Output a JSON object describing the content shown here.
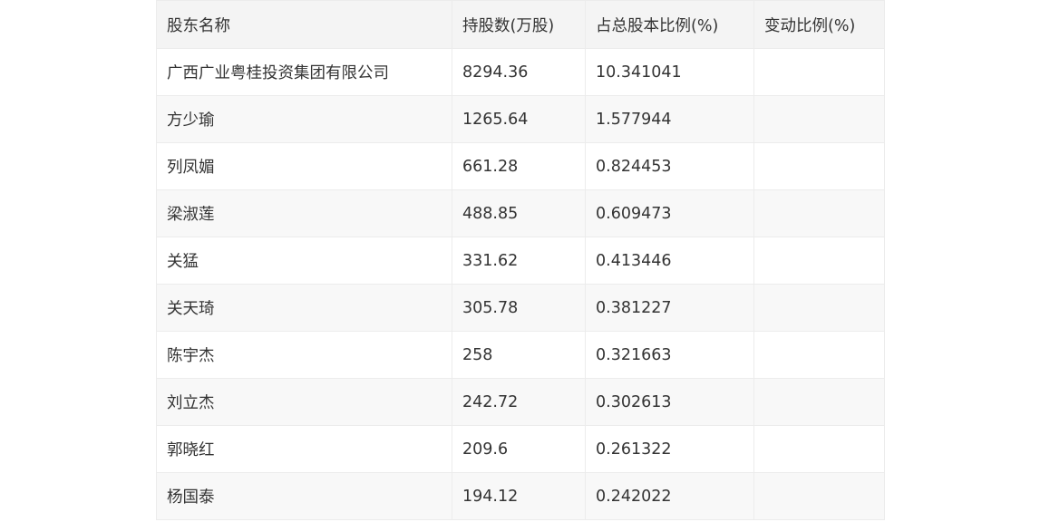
{
  "table": {
    "headers": [
      "股东名称",
      "持股数(万股)",
      "占总股本比例(%)",
      "变动比例(%)"
    ],
    "rows": [
      [
        "广西广业粤桂投资集团有限公司",
        "8294.36",
        "10.341041",
        ""
      ],
      [
        "方少瑜",
        "1265.64",
        "1.577944",
        ""
      ],
      [
        "列凤媚",
        "661.28",
        "0.824453",
        ""
      ],
      [
        "梁淑莲",
        "488.85",
        "0.609473",
        ""
      ],
      [
        "关猛",
        "331.62",
        "0.413446",
        ""
      ],
      [
        "关天琦",
        "305.78",
        "0.381227",
        ""
      ],
      [
        "陈宇杰",
        "258",
        "0.321663",
        ""
      ],
      [
        "刘立杰",
        "242.72",
        "0.302613",
        ""
      ],
      [
        "郭晓红",
        "209.6",
        "0.261322",
        ""
      ],
      [
        "杨国泰",
        "194.12",
        "0.242022",
        ""
      ]
    ]
  }
}
